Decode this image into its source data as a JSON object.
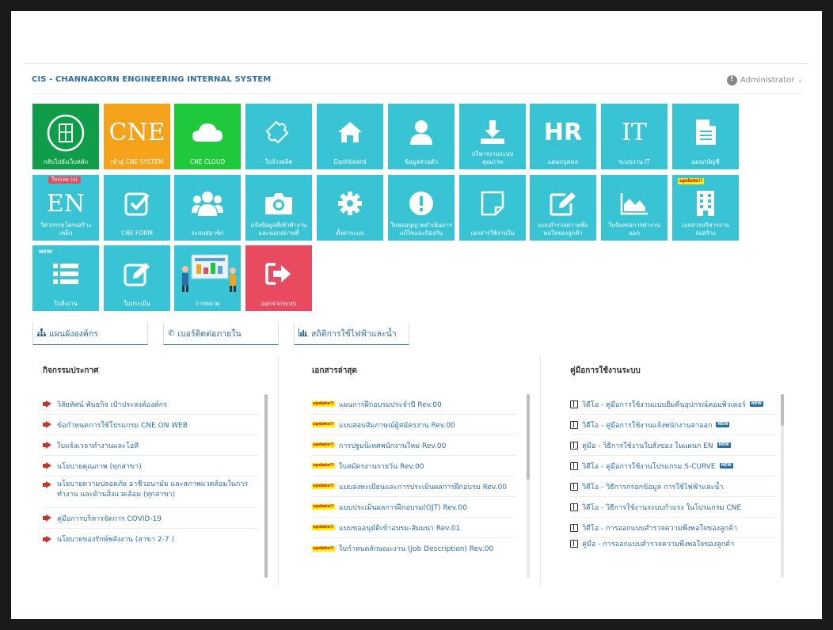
{
  "header": {
    "system_title": "CIS - CHANNAKORN ENGINEERING INTERNAL SYSTEM",
    "user_name": "Administrator"
  },
  "colors": {
    "green": "#0f9d4a",
    "orange": "#f5a31a",
    "bright_green": "#1ec93b",
    "teal": "#38c4d4",
    "red": "#e84a5f",
    "link": "#2c6fa6"
  },
  "tiles": [
    {
      "label": "กลับไปยังเว็บหลัก",
      "icon": "building-circle-icon"
    },
    {
      "label": "เข้าสู่ CNE SYSTEM",
      "icon": "cne-text-icon",
      "icon_text": "CNE"
    },
    {
      "label": "CNE CLOUD",
      "icon": "cloud-icon"
    },
    {
      "label": "ใบจ้างผลิต",
      "icon": "puzzle-icon"
    },
    {
      "label": "Dashboard",
      "icon": "home-icon"
    },
    {
      "label": "ข้อมูลส่วนตัว",
      "icon": "user-icon"
    },
    {
      "label": "บริหารงานระบบคุณภาพ",
      "icon": "download-icon"
    },
    {
      "label": "แผนกบุคคล",
      "icon": "hr-text-icon",
      "icon_text": "HR"
    },
    {
      "label": "ระบบงาน IT",
      "icon": "it-text-icon",
      "icon_text": "IT"
    },
    {
      "label": "แผนกบัญชี",
      "icon": "document-icon"
    },
    {
      "label": "วิศวกรรมโครงสร้างเหล็ก",
      "icon": "en-text-icon",
      "icon_text": "EN",
      "badge": "ใหม่เลย (4)"
    },
    {
      "label": "CNE FORM",
      "icon": "check-square-icon"
    },
    {
      "label": "ระบบสมาชิก",
      "icon": "users-icon"
    },
    {
      "label": "แจ้งข้อมูลที่เข้าทำงานและนอกสถานที่",
      "icon": "camera-icon"
    },
    {
      "label": "ตั้งค่าระบบ",
      "icon": "gear-icon"
    },
    {
      "label": "ใบขออนุญาตดำเนินการแก้ไขและป้องกัน",
      "icon": "alert-icon"
    },
    {
      "label": "เอกสารใช้งานใน",
      "icon": "note-icon"
    },
    {
      "label": "แบบสำรวจความพึงพอใจของลูกค้า",
      "icon": "edit-icon"
    },
    {
      "label": "ใบร้องขอการทำงานนอก",
      "icon": "area-chart-icon"
    },
    {
      "label": "เอกสารบริหารงานก่อสร้าง",
      "icon": "building-icon",
      "badge": "update!!"
    },
    {
      "label": "ใบสั่งงาน",
      "icon": "list-icon",
      "badge": "NEW"
    },
    {
      "label": "ใบประเมิน",
      "icon": "edit-square-icon"
    },
    {
      "label": "การตลาด",
      "icon": "presentation-illustration"
    },
    {
      "label": "ออกจากระบบ",
      "icon": "logout-icon"
    }
  ],
  "quick_buttons": [
    {
      "label": "แผนผังองค์กร",
      "icon": "org-chart-icon"
    },
    {
      "label": "เบอร์ติดต่อภายใน",
      "icon": "phone-icon"
    },
    {
      "label": "สถิติการใช้ไฟฟ้าและน้ำ",
      "icon": "bar-chart-icon"
    }
  ],
  "panels": {
    "news": {
      "title": "กิจกรรมประกาศ",
      "items": [
        "วิสัยทัศน์ พันธกิจ เป้าประสงค์องค์กร",
        "ข้อกำหนดการใช้โปรแกรม CNE ON WEB",
        "ใบแจ้งเวลาทำงานและโอที",
        "นโยบายคุณภาพ (ทุกสาขา)",
        "นโยบายความปลอดภัย อาชีวอนามัย และสภาพแวดล้อมในการทำงาน และด้านสิ่งแวดล้อม (ทุกสาขา)",
        "คู่มือการบริหารจัดการ COVID-19",
        "นโยบายของรักษ์พลังงาน (สาขา 2-7 )"
      ]
    },
    "docs": {
      "title": "เอกสารล่าสุด",
      "badge": "update!!",
      "items": [
        "แผนการฝึกอบรมประจำปี Rev.00",
        "แบบสอบสัมภาษณ์ผู้สมัครงาน Rev.00",
        "การปฐมนิเทศพนักงานใหม่ Rev.00",
        "ใบสมัครงานรายวัน Rev.00",
        "แบบลงทะเบียนและการประเมินผลการฝึกอบรม Rev.00",
        "แบบประเมินผลการฝึกอบรม(OJT) Rev.00",
        "แบบขออนุมัติเข้าอบรม-สัมมนา Rev.01",
        "ใบกำหนดลักษณะงาน (Job Description) Rev.00"
      ]
    },
    "manuals": {
      "title": "คู่มือการใช้งานระบบ",
      "new_badge": "NEW",
      "items": [
        {
          "text": "วิดีโอ - คู่มือการใช้งานแบบยืมคืนอุปกรณ์คอมพิวเตอร์",
          "is_new": true
        },
        {
          "text": "วิดีโอ - คู่มือการใช้งานแจ้งพนักงานลาออก",
          "is_new": true
        },
        {
          "text": "คู่มือ - วิธีการใช้งานใบสั่งของ ในแผนก EN",
          "is_new": true
        },
        {
          "text": "วิดีโอ - คู่มือการใช้งานโปรแกรม S-CURVE",
          "is_new": true
        },
        {
          "text": "วิดีโอ - วิธีการกรอกข้อมูล การใช้ไฟฟ้าและน้ำ",
          "is_new": false
        },
        {
          "text": "วิดีโอ - วิธีการใช้งานระบบกำแรง ในโปรแกรม CNE",
          "is_new": false
        },
        {
          "text": "วิดีโอ - การออกแบบสำรวจความพึงพอใจของลูกค้า",
          "is_new": false
        },
        {
          "text": "คู่มือ - การออกแบบสำรวจความพึงพอใจของลูกค้า",
          "is_new": false
        }
      ]
    }
  }
}
